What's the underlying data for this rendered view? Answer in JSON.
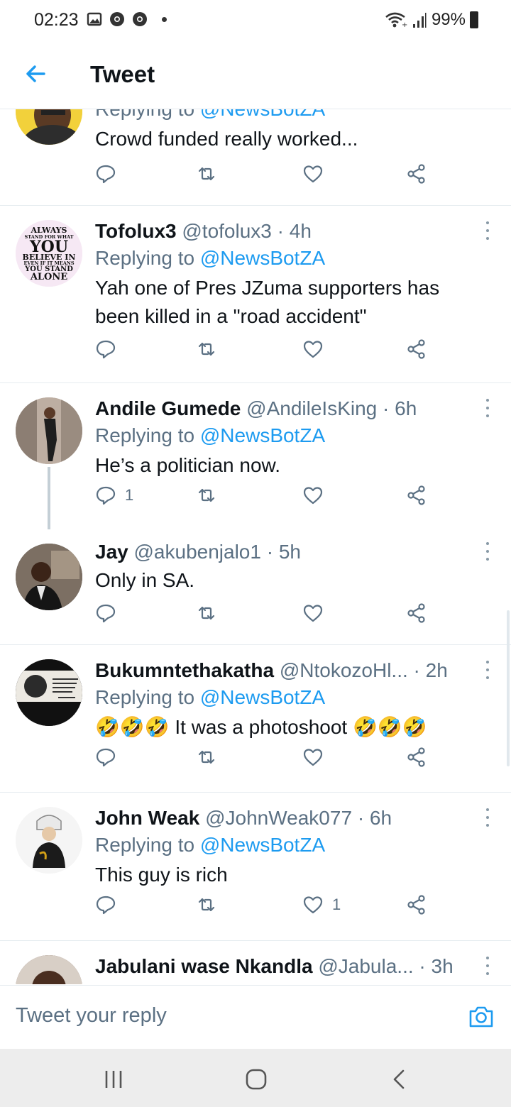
{
  "status_bar": {
    "time": "02:23",
    "battery": "99%"
  },
  "header": {
    "title": "Tweet"
  },
  "tweets": [
    {
      "replying_prefix": "Replying to ",
      "replying_to": "@NewsBotZA",
      "text": "Crowd funded really worked...",
      "replies": "",
      "likes": ""
    },
    {
      "name": "Tofolux3",
      "handle": "@tofolux3",
      "time": "· 4h",
      "replying_prefix": "Replying to ",
      "replying_to": "@NewsBotZA",
      "text": "Yah one of Pres JZuma supporters has been killed in a \"road accident\"",
      "avatar_text": [
        "ALWAYS",
        "STAND FOR WHAT",
        "YOU",
        "BELIEVE IN",
        "EVEN IF IT MEANS",
        "YOU STAND",
        "ALONE"
      ],
      "replies": "",
      "likes": ""
    },
    {
      "name": "Andile Gumede",
      "handle": "@AndileIsKing",
      "time": "· 6h",
      "replying_prefix": "Replying to ",
      "replying_to": "@NewsBotZA",
      "text": "He’s a politician now.",
      "replies": "1",
      "likes": ""
    },
    {
      "name": "Jay",
      "handle": "@akubenjalo1",
      "time": "· 5h",
      "text": "Only in SA.",
      "replies": "",
      "likes": ""
    },
    {
      "name": "Bukumntethakatha",
      "handle": "@NtokozoHl...",
      "time": "· 2h",
      "replying_prefix": "Replying to ",
      "replying_to": "@NewsBotZA",
      "text": "🤣🤣🤣 It was a photoshoot 🤣🤣🤣",
      "replies": "",
      "likes": ""
    },
    {
      "name": "John Weak",
      "handle": "@JohnWeak077",
      "time": "· 6h",
      "replying_prefix": "Replying to ",
      "replying_to": "@NewsBotZA",
      "text": "This guy is rich",
      "replies": "",
      "likes": "1"
    },
    {
      "name": "Jabulani wase Nkandla",
      "handle": "@Jabula...",
      "time": "· 3h"
    }
  ],
  "reply_bar": {
    "placeholder": "Tweet your reply"
  },
  "icons": {
    "back": "arrow-left-icon",
    "reply": "speech-bubble-icon",
    "retweet": "retweet-icon",
    "like": "heart-icon",
    "share": "share-icon",
    "more": "vertical-dots-icon",
    "camera": "camera-icon"
  },
  "colors": {
    "accent": "#1d9bf0",
    "secondary_text": "#5b7083"
  }
}
